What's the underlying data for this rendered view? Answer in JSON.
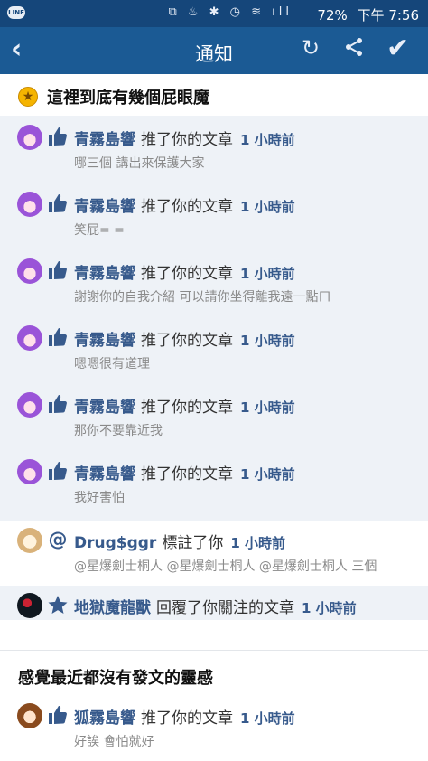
{
  "status_bar": {
    "line_badge": "LINE",
    "icons": "⧉ ♨ ✱ ◷ ≋ ıll",
    "battery": "72%",
    "time": "下午 7:56"
  },
  "header": {
    "title": "通知"
  },
  "sections": [
    {
      "title": "這裡到底有幾個屁眼魔",
      "items": [
        {
          "user": "青霧島響",
          "action": "推了你的文章",
          "time": "1 小時前",
          "comment": "哪三個 講出來保護大家"
        },
        {
          "user": "青霧島響",
          "action": "推了你的文章",
          "time": "1 小時前",
          "comment": "笑屁= ="
        },
        {
          "user": "青霧島響",
          "action": "推了你的文章",
          "time": "1 小時前",
          "comment": "謝謝你的自我介紹 可以請你坐得離我遠一點ㄇ"
        },
        {
          "user": "青霧島響",
          "action": "推了你的文章",
          "time": "1 小時前",
          "comment": "嗯嗯很有道理"
        },
        {
          "user": "青霧島響",
          "action": "推了你的文章",
          "time": "1 小時前",
          "comment": "那你不要靠近我"
        },
        {
          "user": "青霧島響",
          "action": "推了你的文章",
          "time": "1 小時前",
          "comment": "我好害怕"
        },
        {
          "user": "Drug$ggr",
          "action": "標註了你",
          "time": "1 小時前",
          "comment": "@星爆劍士桐人 @星爆劍士桐人 @星爆劍士桐人 三個"
        },
        {
          "user": "地獄魔龍獸",
          "action": "回覆了你關注的文章",
          "time": "1 小時前",
          "comment": ""
        }
      ]
    },
    {
      "title": "感覺最近都沒有發文的靈感",
      "items": [
        {
          "user": "狐霧島響",
          "action": "推了你的文章",
          "time": "1 小時前",
          "comment": "好誒 會怕就好"
        }
      ]
    }
  ],
  "icon_names": [
    "line-app-icon",
    "back-arrow-icon",
    "refresh-icon",
    "share-icon",
    "check-icon",
    "star-badge-icon",
    "thumbs-up-icon",
    "at-mention-icon",
    "star-follow-icon"
  ],
  "colors": {
    "status_bar": "#15467a",
    "header": "#1b5a94",
    "unread_bg": "#eef2f7",
    "username": "#375a8c",
    "comment": "#8a8a8a"
  }
}
